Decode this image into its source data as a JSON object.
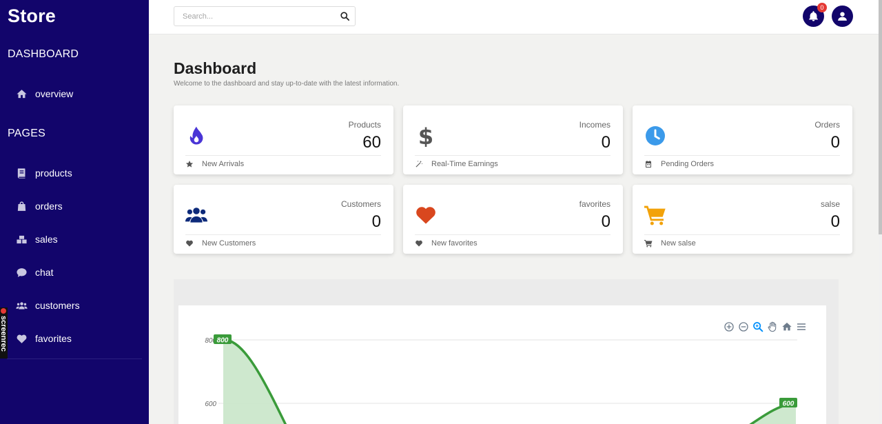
{
  "brand": "Store",
  "sidebar": {
    "section_dashboard": "DASHBOARD",
    "section_pages": "PAGES",
    "items": [
      {
        "label": "overview",
        "icon": "home-icon"
      },
      {
        "label": "products",
        "icon": "book-icon"
      },
      {
        "label": "orders",
        "icon": "bag-icon"
      },
      {
        "label": "sales",
        "icon": "boxes-icon"
      },
      {
        "label": "chat",
        "icon": "chat-icon"
      },
      {
        "label": "customers",
        "icon": "users-icon"
      },
      {
        "label": "favorites",
        "icon": "heart-icon"
      }
    ]
  },
  "topbar": {
    "search_placeholder": "Search...",
    "notification_count": "0"
  },
  "header": {
    "title": "Dashboard",
    "subtitle": "Welcome to the dashboard and stay up-to-date with the latest information."
  },
  "cards": [
    {
      "label": "Products",
      "value": "60",
      "footer": "New Arrivals",
      "icon": "fire-icon",
      "icon_color": "#4a35d6"
    },
    {
      "label": "Incomes",
      "value": "0",
      "footer": "Real-Time Earnings",
      "icon": "dollar-icon",
      "icon_color": "#555555"
    },
    {
      "label": "Orders",
      "value": "0",
      "footer": "Pending Orders",
      "icon": "clock-icon",
      "icon_color": "#3b9aea"
    },
    {
      "label": "Customers",
      "value": "0",
      "footer": "New Customers",
      "icon": "users-icon",
      "icon_color": "#0d2a7a"
    },
    {
      "label": "favorites",
      "value": "0",
      "footer": "New favorites",
      "icon": "heart-icon",
      "icon_color": "#d9471e"
    },
    {
      "label": "salse",
      "value": "0",
      "footer": "New salse",
      "icon": "cart-icon",
      "icon_color": "#f2a20a"
    }
  ],
  "colors": {
    "sidebar": "#12056b",
    "chart_line": "#3a9b3a",
    "chart_fill": "#c9e6c9"
  },
  "chart_data": {
    "type": "area",
    "y_ticks": [
      "800",
      "600"
    ],
    "series": [
      {
        "values": [
          800,
          600
        ]
      }
    ],
    "data_labels": [
      "800",
      "600"
    ]
  }
}
